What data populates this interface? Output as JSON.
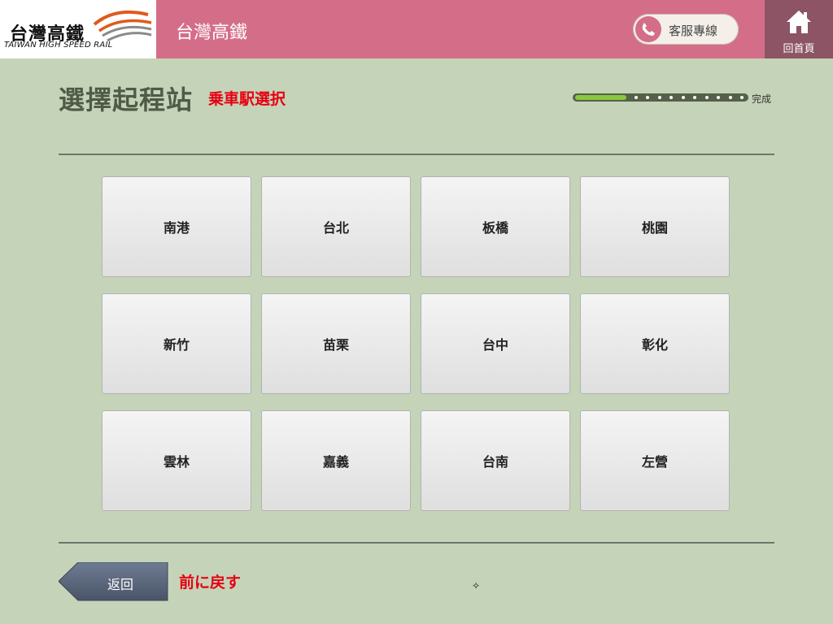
{
  "header": {
    "logo_zh": "台灣高鐵",
    "logo_en": "TAIWAN HIGH SPEED RAIL",
    "title": "台灣高鐵",
    "hotline_label": "客服專線",
    "home_label": "回首頁",
    "brand_color": "#d46e88"
  },
  "page": {
    "title": "選擇起程站",
    "subtitle": "乗車駅選択",
    "progress_end_label": "完成",
    "progress_fraction": 0.3
  },
  "stations": [
    "南港",
    "台北",
    "板橋",
    "桃園",
    "新竹",
    "苗栗",
    "台中",
    "彰化",
    "雲林",
    "嘉義",
    "台南",
    "左營"
  ],
  "footer": {
    "back_label": "返回",
    "back_hint": "前に戻す"
  },
  "icons": {
    "phone": "phone-icon",
    "home": "home-icon",
    "cursor": "cursor-icon"
  }
}
